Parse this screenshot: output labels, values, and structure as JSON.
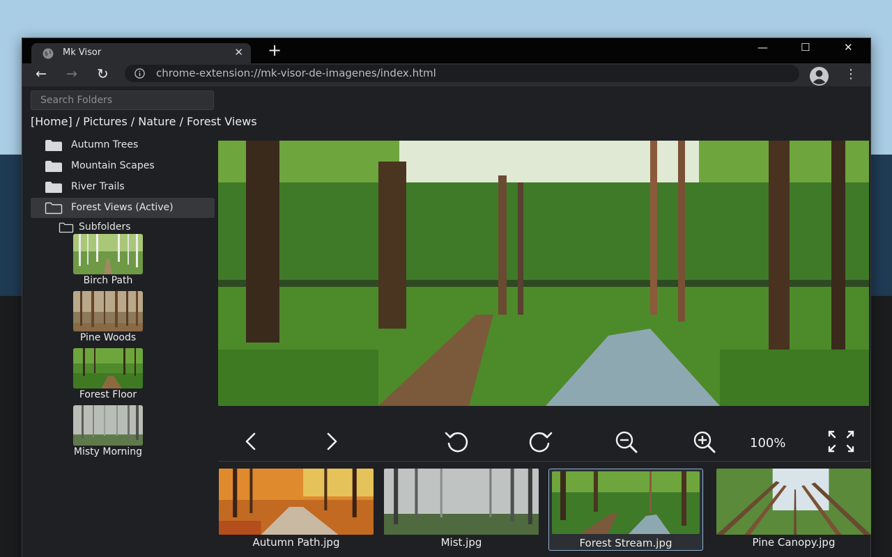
{
  "tab": {
    "title": "Mk Visor",
    "close": "✕",
    "new_tab": "+"
  },
  "window_controls": {
    "minimize": "—",
    "maximize": "☐",
    "close": "✕"
  },
  "toolbar": {
    "back": "←",
    "forward": "→",
    "reload": "↻",
    "url": "chrome-extension://mk-visor-de-imagenes/index.html",
    "menu": "⋮"
  },
  "search": {
    "placeholder": "Search Folders",
    "value": ""
  },
  "breadcrumb": [
    "[Home]",
    "Pictures",
    "Nature",
    "Forest Views"
  ],
  "breadcrumb_separator": " / ",
  "folders": [
    {
      "label": "Autumn Trees",
      "active": false
    },
    {
      "label": "Mountain Scapes",
      "active": false
    },
    {
      "label": "River Trails",
      "active": false
    },
    {
      "label": "Forest Views (Active)",
      "active": true
    }
  ],
  "subfolders": {
    "label": "Subfolders",
    "items": [
      {
        "label": "Birch Path"
      },
      {
        "label": "Pine Woods"
      },
      {
        "label": "Forest Floor"
      },
      {
        "label": "Misty Morning"
      }
    ]
  },
  "viewer": {
    "zoom": "100%"
  },
  "controls": [
    "previous",
    "next",
    "rotate-left",
    "rotate-right",
    "zoom-out",
    "zoom-in",
    "fullscreen"
  ],
  "filmstrip": [
    {
      "label": "Autumn Path.jpg",
      "selected": false
    },
    {
      "label": "Mist.jpg",
      "selected": false
    },
    {
      "label": "Forest Stream.jpg",
      "selected": true
    },
    {
      "label": "Pine Canopy.jpg",
      "selected": false
    }
  ],
  "colors": {
    "window": "#1f2023",
    "tabstrip": "#040405",
    "tab": "#2b2c2f",
    "accent": "#8fb3d1",
    "text": "#ebebeb"
  }
}
